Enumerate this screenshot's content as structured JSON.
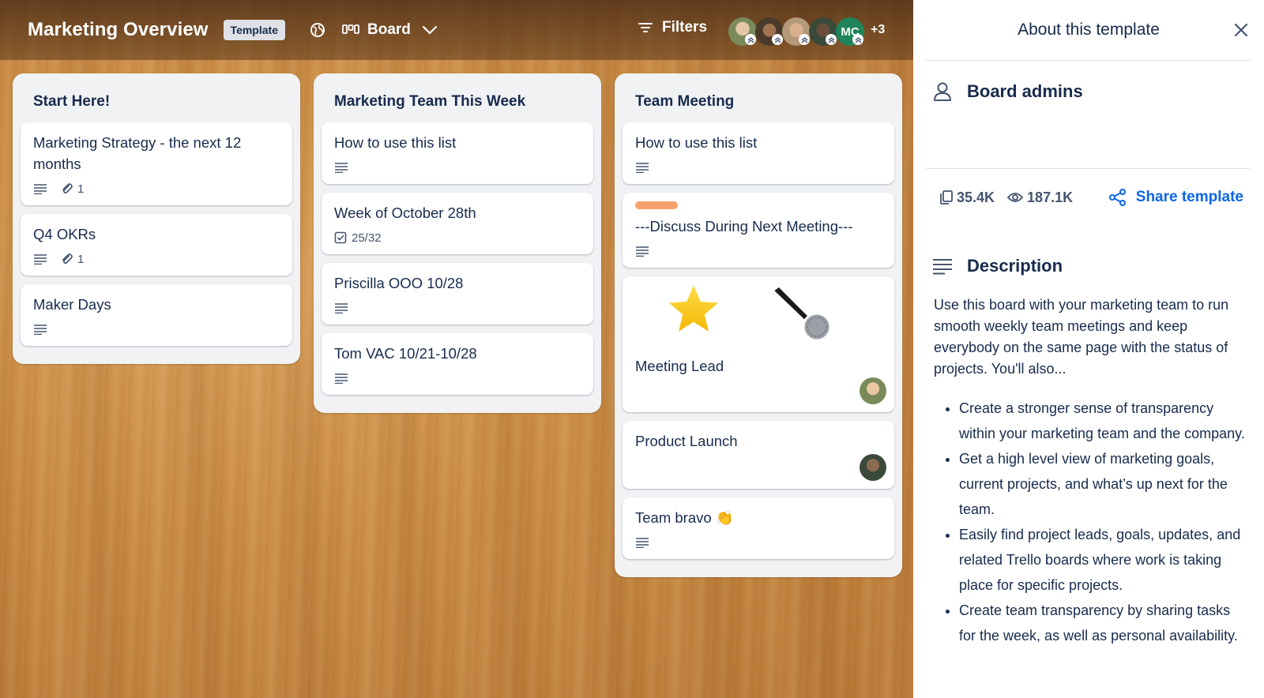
{
  "board": {
    "title": "Marketing Overview",
    "template_badge": "Template",
    "view_label": "Board",
    "filters_label": "Filters",
    "members": [
      {
        "name": "member-1",
        "color": "#7a8a5a"
      },
      {
        "name": "member-2",
        "color": "#4a3a2a"
      },
      {
        "name": "member-3",
        "color": "#b49a7a"
      },
      {
        "name": "member-4",
        "color": "#3a4a3a"
      },
      {
        "name": "member-5",
        "initials": "MC",
        "color": "#1f845a"
      }
    ],
    "more_members": "+3"
  },
  "lists": [
    {
      "title": "Start Here!",
      "cards": [
        {
          "title": "Marketing Strategy - the next 12 months",
          "attachments": "1"
        },
        {
          "title": "Q4 OKRs",
          "attachments": "1"
        },
        {
          "title": "Maker Days"
        }
      ]
    },
    {
      "title": "Marketing Team This Week",
      "cards": [
        {
          "title": "How to use this list"
        },
        {
          "title": "Week of October 28th",
          "checklist": "25/32"
        },
        {
          "title": "Priscilla OOO 10/28"
        },
        {
          "title": "Tom VAC 10/21-10/28"
        }
      ]
    },
    {
      "title": "Team Meeting",
      "cards": [
        {
          "title": "How to use this list"
        },
        {
          "title": "---Discuss During Next Meeting---",
          "label_color": "#f5a36b"
        },
        {
          "title": "Meeting Lead"
        },
        {
          "title": "Product Launch"
        },
        {
          "title": "Team bravo 👏"
        }
      ]
    }
  ],
  "panel": {
    "title": "About this template",
    "admins_heading": "Board admins",
    "copies": "35.4K",
    "views": "187.1K",
    "share_label": "Share template",
    "description_heading": "Description",
    "description": "Use this board with your marketing team to run smooth weekly team meetings and keep everybody on the same page with the status of projects. You'll also...",
    "bullets": [
      "Create a stronger sense of transparency within your marketing team and the company.",
      "Get a high level view of marketing goals, current projects, and what’s up next for the team.",
      "Easily find project leads, goals, updates, and related Trello boards where work is taking place for specific projects.",
      "Create team transparency by sharing tasks for the week, as well as personal availability."
    ]
  },
  "colors": {
    "accent": "#0c66e4",
    "badge_bg": "#dfe1e6"
  }
}
